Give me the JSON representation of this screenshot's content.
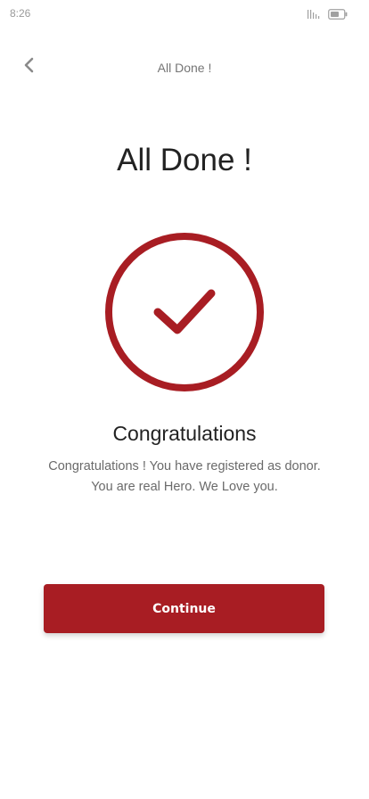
{
  "status_bar": {
    "time": "8:26",
    "icons": [
      "signal-icon",
      "battery-icon"
    ]
  },
  "header": {
    "title": "All Done !",
    "back_icon": "chevron-left-icon"
  },
  "main": {
    "title": "All Done !",
    "success_icon": "check-circle-icon",
    "heading": "Congratulations",
    "line1": "Congratulations ! You have registered as donor.",
    "line2": "You are real Hero. We Love you."
  },
  "actions": {
    "continue_label": "Continue"
  },
  "colors": {
    "accent": "#a81d23",
    "title_text": "#222222",
    "body_text": "#6a6a6a",
    "muted": "#9a9a9a"
  }
}
